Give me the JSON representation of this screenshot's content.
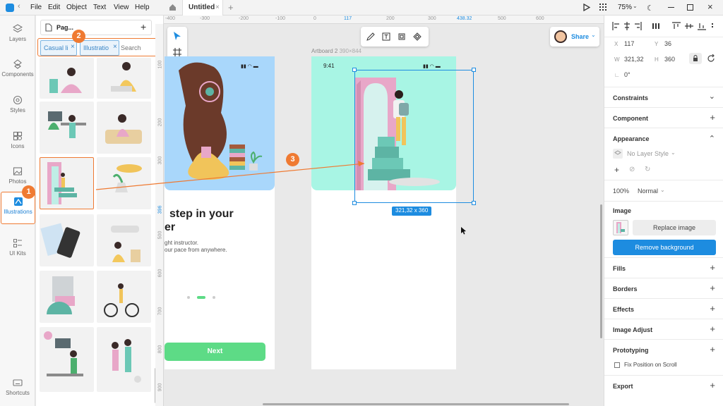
{
  "menu": {
    "file": "File",
    "edit": "Edit",
    "object": "Object",
    "text": "Text",
    "view": "View",
    "help": "Help"
  },
  "tab": {
    "title": "Untitled"
  },
  "zoom": "75%",
  "leftbar": {
    "layers": "Layers",
    "components": "Components",
    "styles": "Styles",
    "icons": "Icons",
    "photos": "Photos",
    "illustrations": "Illustrations",
    "ui_kits": "UI Kits",
    "shortcuts": "Shortcuts"
  },
  "assets": {
    "page_label": "Pag...",
    "chips": [
      "Casual li",
      "Illustratio"
    ],
    "search_placeholder": "Search"
  },
  "badges": {
    "one": "1",
    "two": "2",
    "three": "3"
  },
  "ruler_top": [
    "-400",
    "-300",
    "-200",
    "-100",
    "0",
    "117",
    "200",
    "300",
    "438.32",
    "500",
    "600"
  ],
  "ruler_left": [
    "100",
    "200",
    "300",
    "396",
    "500",
    "600",
    "700",
    "800",
    "900"
  ],
  "tools": {
    "share": "Share"
  },
  "artboard1": {
    "headline1": "step in your",
    "headline2": "er",
    "line1": "ght instructor.",
    "line2": "our pace from anywhere.",
    "next": "Next"
  },
  "artboard2": {
    "label": "Artboard 2",
    "size": "390×844",
    "time": "9:41"
  },
  "selection_size": "321,32 x 360",
  "inspector": {
    "x_label": "X",
    "x": "117",
    "y_label": "Y",
    "y": "36",
    "w_label": "W",
    "w": "321,32",
    "h_label": "H",
    "h": "360",
    "rotation": "0°",
    "constraints": "Constraints",
    "component": "Component",
    "appearance": "Appearance",
    "no_layer_style": "No Layer Style",
    "opacity": "100%",
    "blend": "Normal",
    "image": "Image",
    "replace_image": "Replace image",
    "remove_background": "Remove background",
    "fills": "Fills",
    "borders": "Borders",
    "effects": "Effects",
    "image_adjust": "Image Adjust",
    "prototyping": "Prototyping",
    "fix_position": "Fix Position on Scroll",
    "export": "Export"
  },
  "colors": {
    "accent": "#1d8ce0",
    "orange": "#ef7a32",
    "mint": "#a8f5e4",
    "skyblue": "#a9d7fb",
    "pink": "#e8a7c8",
    "green": "#5ddb86"
  }
}
